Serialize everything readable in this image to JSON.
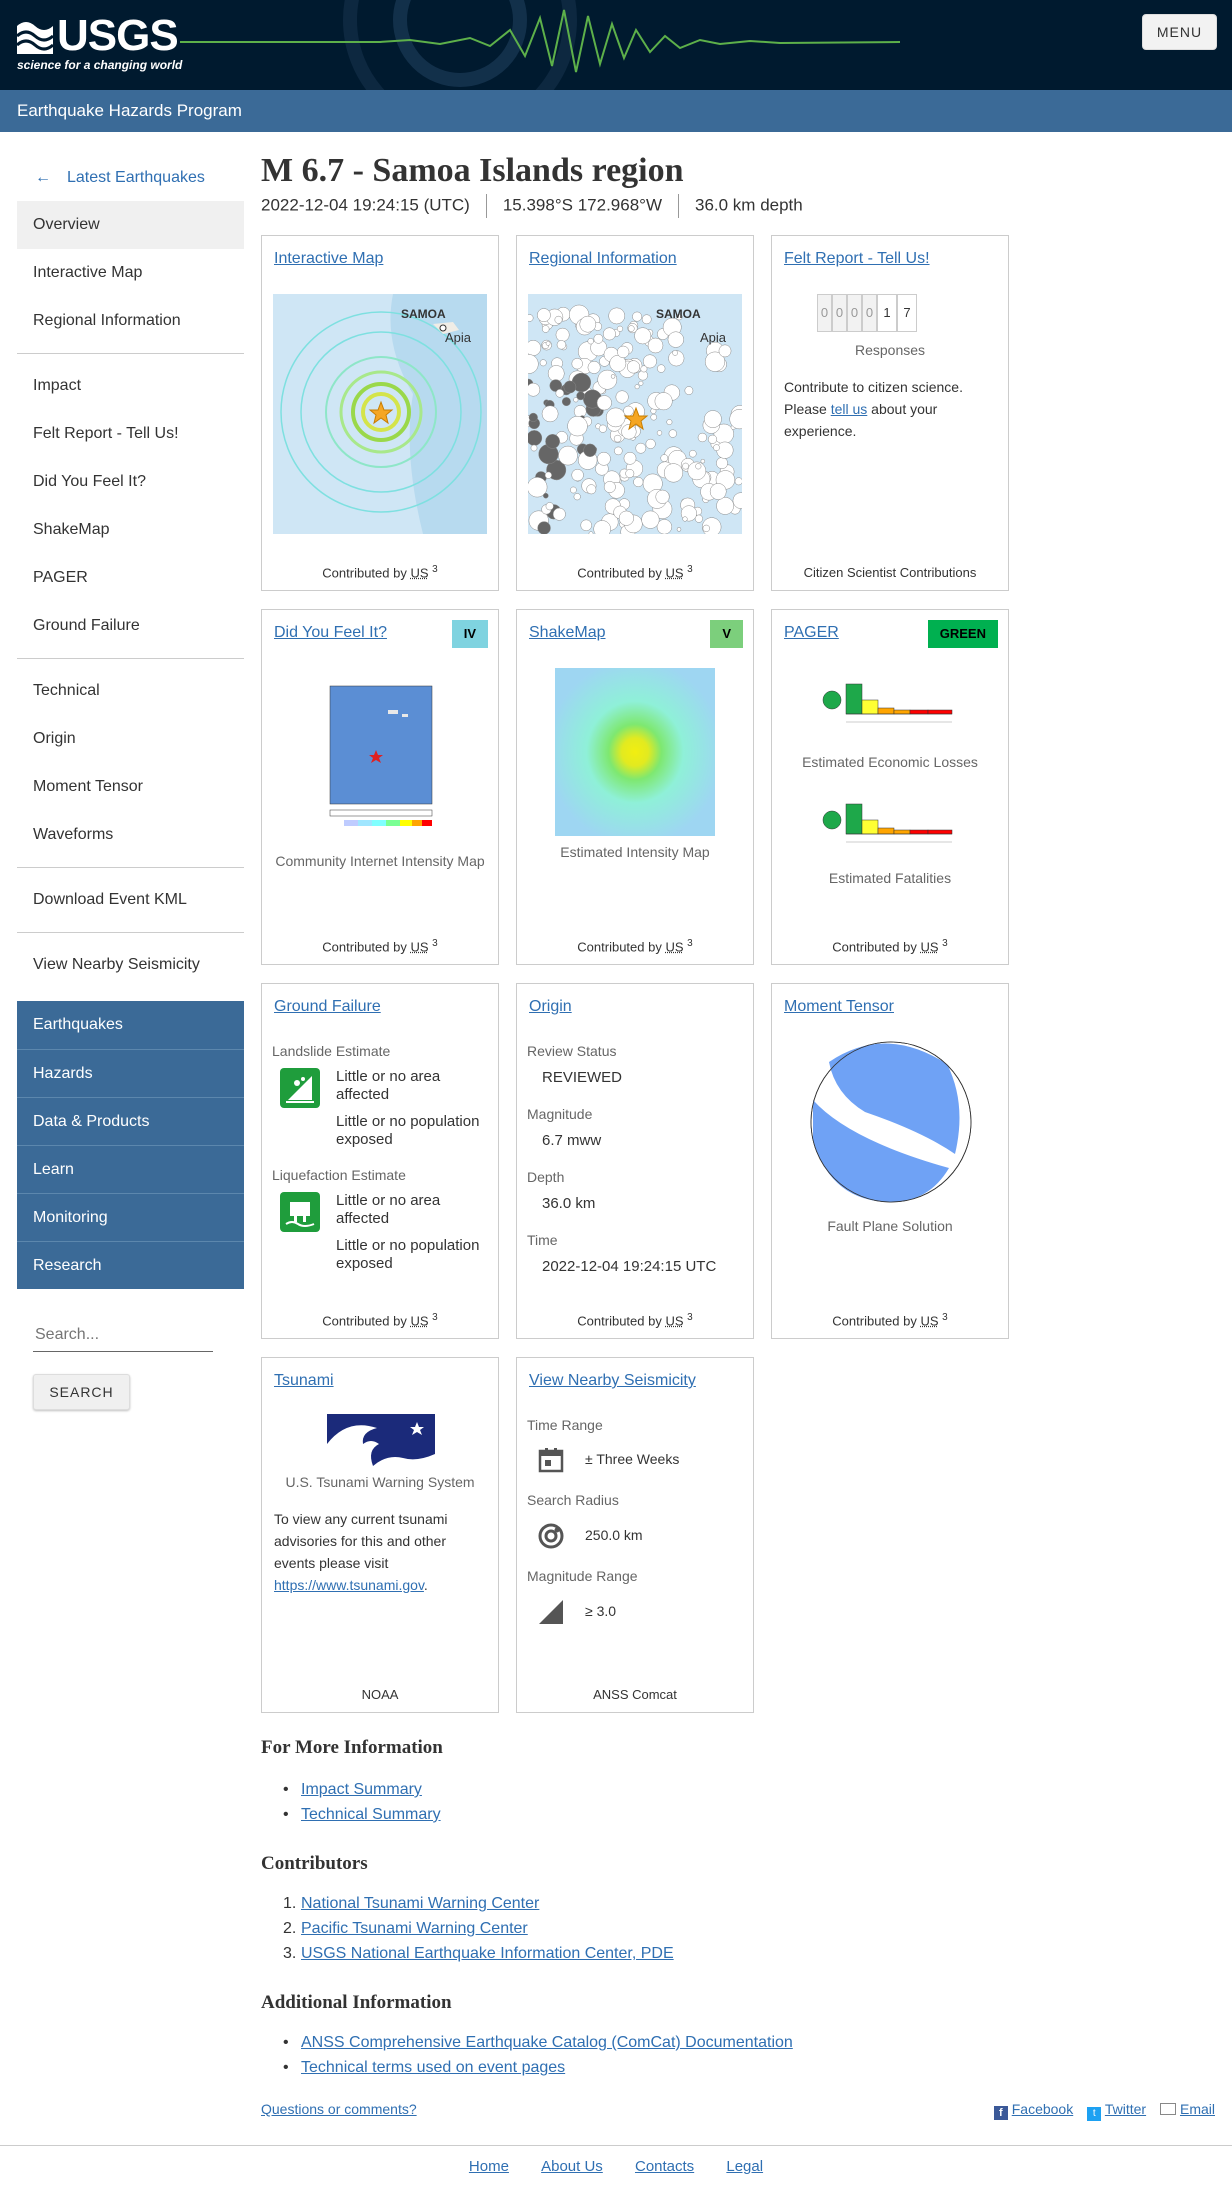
{
  "header": {
    "logo_text": "USGS",
    "logo_tagline": "science for a changing world",
    "menu_label": "MENU",
    "program": "Earthquake Hazards Program"
  },
  "sidebar": {
    "back_label": "Latest Earthquakes",
    "groups": [
      [
        "Overview",
        "Interactive Map",
        "Regional Information"
      ],
      [
        "Impact",
        "Felt Report - Tell Us!",
        "Did You Feel It?",
        "ShakeMap",
        "PAGER",
        "Ground Failure"
      ],
      [
        "Technical",
        "Origin",
        "Moment Tensor",
        "Waveforms"
      ],
      [
        "Download Event KML"
      ],
      [
        "View Nearby Seismicity"
      ]
    ],
    "nav": [
      "Earthquakes",
      "Hazards",
      "Data & Products",
      "Learn",
      "Monitoring",
      "Research"
    ],
    "search_placeholder": "Search...",
    "search_button": "SEARCH"
  },
  "event": {
    "title": "M 6.7 - Samoa Islands region",
    "time": "2022-12-04 19:24:15 (UTC)",
    "location": "15.398°S 172.968°W",
    "depth": "36.0 km depth"
  },
  "cards": {
    "interactive_map": {
      "title": "Interactive Map",
      "footer": "Contributed by",
      "src": "US",
      "sup": "3",
      "map_labels": [
        "SAMOA",
        "Apia"
      ]
    },
    "regional": {
      "title": "Regional Information",
      "footer": "Contributed by",
      "src": "US",
      "sup": "3",
      "map_labels": [
        "SAMOA",
        "Apia"
      ]
    },
    "felt": {
      "title": "Felt Report - Tell Us!",
      "digits": [
        "0",
        "0",
        "0",
        "0",
        "1",
        "7"
      ],
      "responses": "Responses",
      "text1": "Contribute to citizen science. Please ",
      "link": "tell us",
      "text2": " about your experience.",
      "footer": "Citizen Scientist Contributions"
    },
    "dyfi": {
      "title": "Did You Feel It?",
      "badge": "IV",
      "badge_color": "#7fd3e0",
      "caption": "Community Internet Intensity Map",
      "footer": "Contributed by",
      "src": "US",
      "sup": "3"
    },
    "shakemap": {
      "title": "ShakeMap",
      "badge": "V",
      "badge_color": "#7ccf7c",
      "caption": "Estimated Intensity Map",
      "footer": "Contributed by",
      "src": "US",
      "sup": "3"
    },
    "pager": {
      "title": "PAGER",
      "badge": "GREEN",
      "badge_color": "#00b050",
      "caption1": "Estimated Economic Losses",
      "caption2": "Estimated Fatalities",
      "footer": "Contributed by",
      "src": "US",
      "sup": "3"
    },
    "ground_failure": {
      "title": "Ground Failure",
      "landslide_label": "Landslide Estimate",
      "liquefaction_label": "Liquefaction Estimate",
      "area": "Little or no area affected",
      "population": "Little or no population exposed",
      "footer": "Contributed by",
      "src": "US",
      "sup": "3"
    },
    "origin": {
      "title": "Origin",
      "review_label": "Review Status",
      "review": "REVIEWED",
      "mag_label": "Magnitude",
      "mag": "6.7 mww",
      "depth_label": "Depth",
      "depth": "36.0 km",
      "time_label": "Time",
      "time": "2022-12-04 19:24:15 UTC",
      "footer": "Contributed by",
      "src": "US",
      "sup": "3"
    },
    "moment_tensor": {
      "title": "Moment Tensor",
      "caption": "Fault Plane Solution",
      "footer": "Contributed by",
      "src": "US",
      "sup": "3"
    },
    "tsunami": {
      "title": "Tsunami",
      "caption": "U.S. Tsunami Warning System",
      "text": "To view any current tsunami advisories for this and other events please visit ",
      "link": "https://www.tsunami.gov",
      "footer": "NOAA"
    },
    "nearby": {
      "title": "View Nearby Seismicity",
      "time_label": "Time Range",
      "time": "± Three Weeks",
      "radius_label": "Search Radius",
      "radius": "250.0 km",
      "mag_label": "Magnitude Range",
      "mag": "≥ 3.0",
      "footer": "ANSS Comcat"
    }
  },
  "more_info": {
    "heading": "For More Information",
    "links": [
      "Impact Summary",
      "Technical Summary"
    ]
  },
  "contributors": {
    "heading": "Contributors",
    "links": [
      "National Tsunami Warning Center",
      "Pacific Tsunami Warning Center",
      "USGS National Earthquake Information Center, PDE"
    ]
  },
  "additional": {
    "heading": "Additional Information",
    "links": [
      "ANSS Comprehensive Earthquake Catalog (ComCat) Documentation",
      "Technical terms used on event pages"
    ]
  },
  "questions": "Questions or comments?",
  "share": [
    "Facebook",
    "Twitter",
    "Email"
  ],
  "footer_links": [
    "Home",
    "About Us",
    "Contacts",
    "Legal"
  ]
}
